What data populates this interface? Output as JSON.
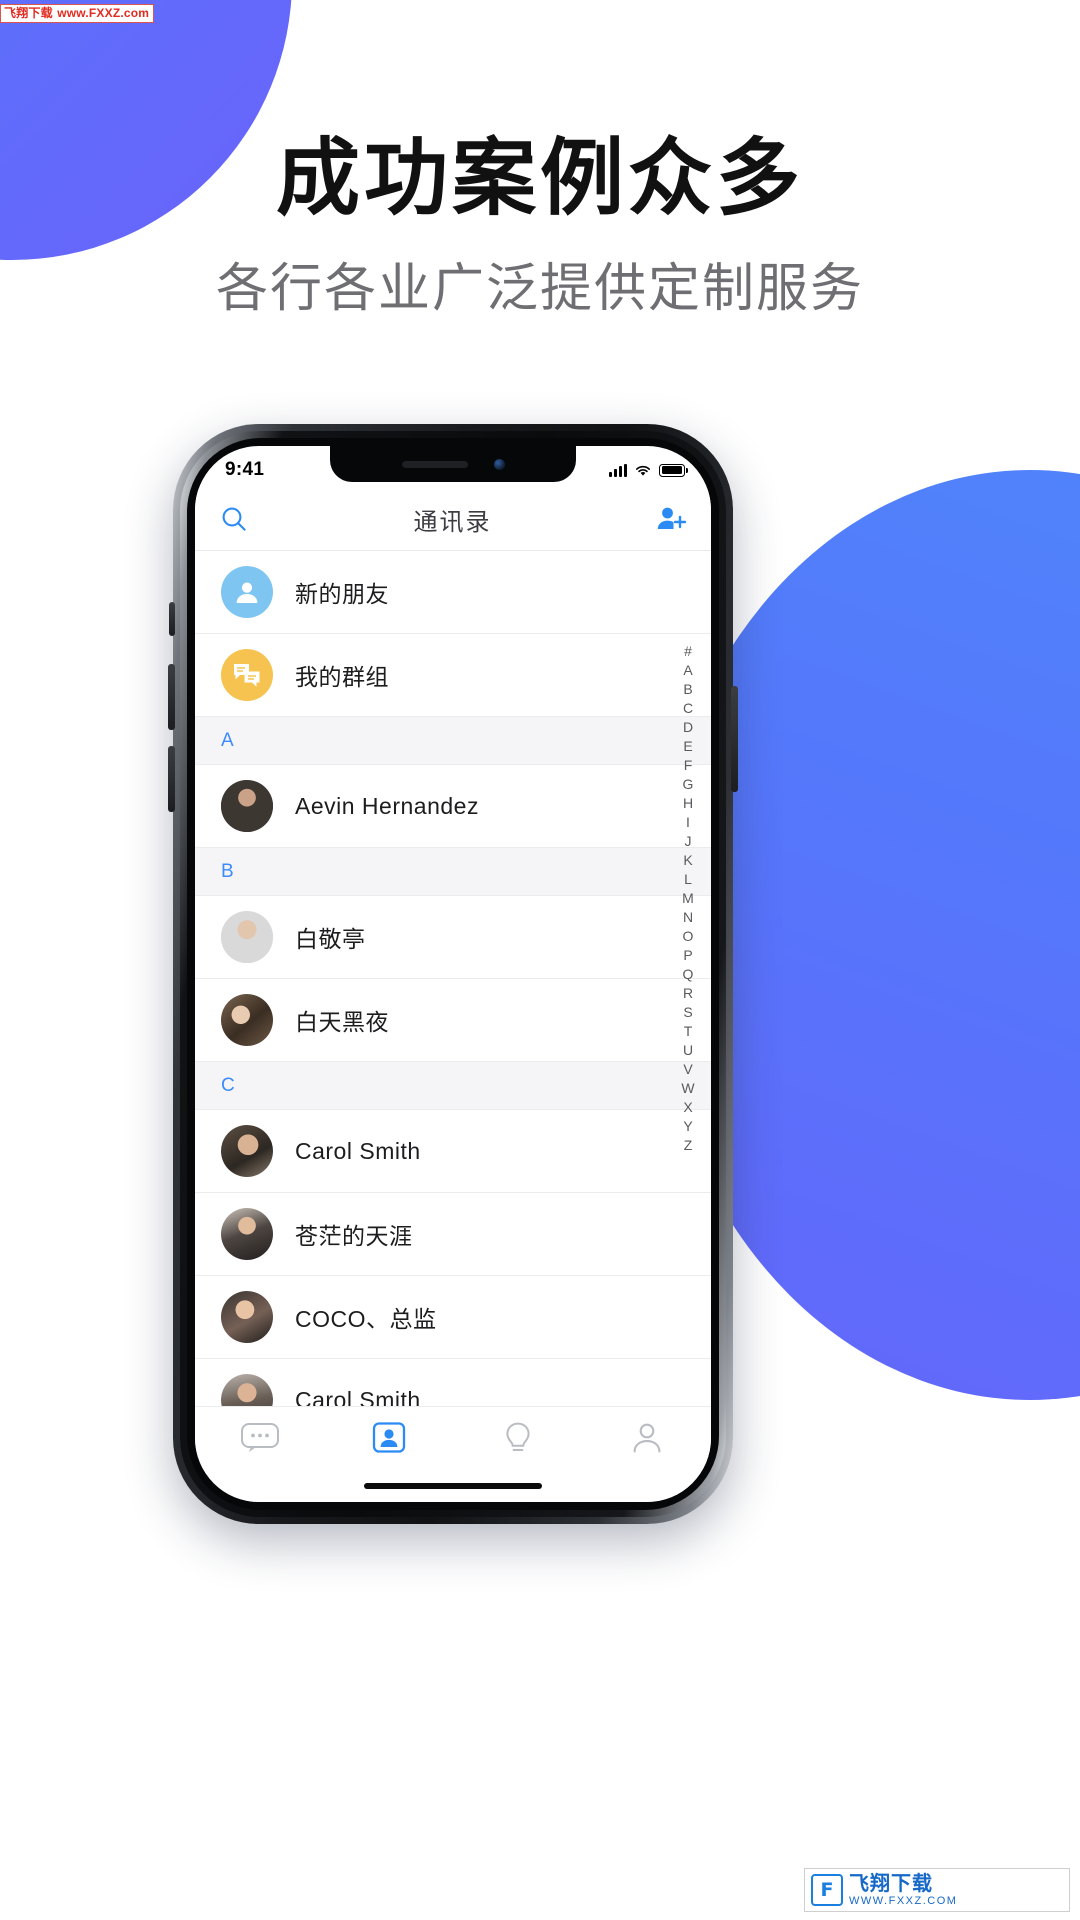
{
  "watermark": {
    "top_zh": "飞翔下载",
    "top_url": "www.FXXZ.com",
    "bottom_logo": "F",
    "bottom_title": "飞翔下载",
    "bottom_url": "WWW.FXXZ.COM"
  },
  "promo": {
    "headline": "成功案例众多",
    "subheadline": "各行各业广泛提供定制服务",
    "accent_blue": "#5b6ffb",
    "accent_blue2": "#4f86fb"
  },
  "phone": {
    "status_bar": {
      "time": "9:41",
      "signal_icon": "signal-bars-icon",
      "wifi_icon": "wifi-icon",
      "battery_icon": "battery-icon"
    },
    "navbar": {
      "search_icon": "search-icon",
      "title": "通讯录",
      "add_contact_icon": "add-person-icon"
    },
    "quick_entries": [
      {
        "label": "新的朋友",
        "icon": "person-circle-icon",
        "color": "#7ec5f2"
      },
      {
        "label": "我的群组",
        "icon": "group-chat-icon",
        "color": "#f6c350"
      }
    ],
    "sections": [
      {
        "letter": "A",
        "contacts": [
          {
            "name": "Aevin Hernandez",
            "avatar": "photo-1"
          }
        ]
      },
      {
        "letter": "B",
        "contacts": [
          {
            "name": "白敬亭",
            "avatar": "photo-2"
          },
          {
            "name": "白天黑夜",
            "avatar": "photo-3"
          }
        ]
      },
      {
        "letter": "C",
        "contacts": [
          {
            "name": "Carol Smith",
            "avatar": "photo-4"
          },
          {
            "name": "苍茫的天涯",
            "avatar": "photo-5"
          },
          {
            "name": "COCO、总监",
            "avatar": "photo-6"
          },
          {
            "name": "Carol Smith",
            "avatar": "photo-7"
          },
          {
            "name": "",
            "avatar": "photo-8"
          }
        ]
      }
    ],
    "index_letters": [
      "#",
      "A",
      "B",
      "C",
      "D",
      "E",
      "F",
      "G",
      "H",
      "I",
      "J",
      "K",
      "L",
      "M",
      "N",
      "O",
      "P",
      "Q",
      "R",
      "S",
      "T",
      "U",
      "V",
      "W",
      "X",
      "Y",
      "Z"
    ],
    "tab_bar": [
      {
        "icon": "chat-bubble-icon",
        "active": false
      },
      {
        "icon": "contacts-card-icon",
        "active": true
      },
      {
        "icon": "lightbulb-icon",
        "active": false
      },
      {
        "icon": "person-outline-icon",
        "active": false
      }
    ],
    "tab_active_color": "#2b8bf5",
    "tab_inactive_color": "#b9bcc2"
  }
}
